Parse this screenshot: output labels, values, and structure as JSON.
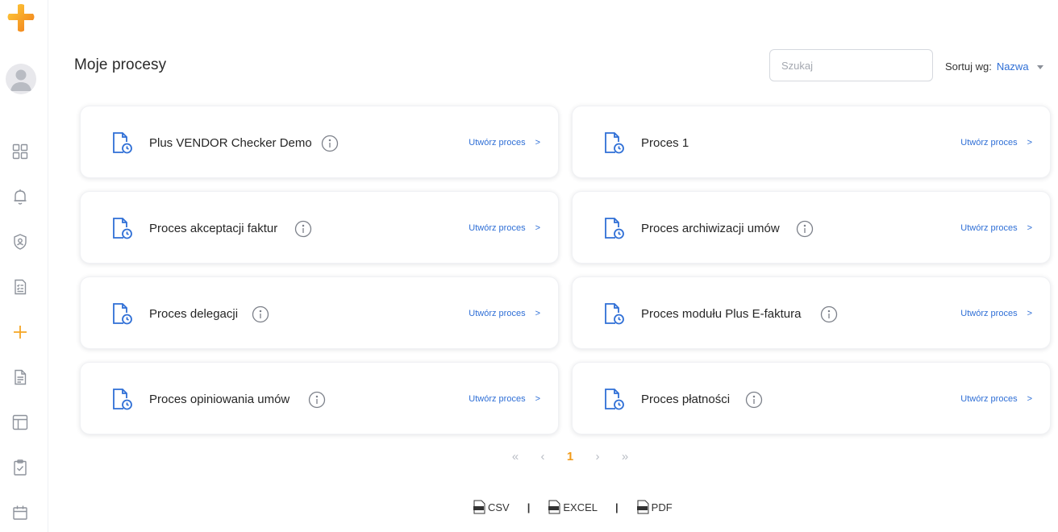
{
  "sidebar": {
    "items": [
      {
        "name": "dashboard-icon"
      },
      {
        "name": "bell-icon"
      },
      {
        "name": "shield-user-icon"
      },
      {
        "name": "checklist-icon"
      },
      {
        "name": "plus-icon"
      },
      {
        "name": "document-icon"
      },
      {
        "name": "layout-icon"
      },
      {
        "name": "clipboard-check-icon"
      },
      {
        "name": "calendar-icon"
      }
    ],
    "accent_color": "#f5a623"
  },
  "header": {
    "title": "Moje procesy",
    "search_placeholder": "Szukaj",
    "sort_label": "Sortuj wg:",
    "sort_value": "Nazwa"
  },
  "cards": [
    {
      "title": "Plus VENDOR Checker Demo",
      "has_info": true,
      "link": "Utwórz proces",
      "arrow": ">"
    },
    {
      "title": "Proces 1",
      "has_info": false,
      "link": "Utwórz proces",
      "arrow": ">"
    },
    {
      "title": "Proces akceptacji faktur",
      "has_info": true,
      "link": "Utwórz proces",
      "arrow": ">"
    },
    {
      "title": "Proces archiwizacji umów",
      "has_info": true,
      "link": "Utwórz proces",
      "arrow": ">"
    },
    {
      "title": "Proces delegacji",
      "has_info": true,
      "link": "Utwórz proces",
      "arrow": ">"
    },
    {
      "title": "Proces modułu Plus E-faktura",
      "has_info": true,
      "link": "Utwórz proces",
      "arrow": ">"
    },
    {
      "title": "Proces opiniowania umów",
      "has_info": true,
      "link": "Utwórz proces",
      "arrow": ">"
    },
    {
      "title": "Proces płatności",
      "has_info": true,
      "link": "Utwórz proces",
      "arrow": ">"
    }
  ],
  "pagination": {
    "first": "«",
    "prev": "‹",
    "current": "1",
    "next": "›",
    "last": "»"
  },
  "export": {
    "csv": "CSV",
    "excel": "EXCEL",
    "pdf": "PDF",
    "separator": "|"
  },
  "colors": {
    "link": "#2f6fd6",
    "current_page": "#f29b19",
    "doc_icon": "#2f6fd6"
  }
}
